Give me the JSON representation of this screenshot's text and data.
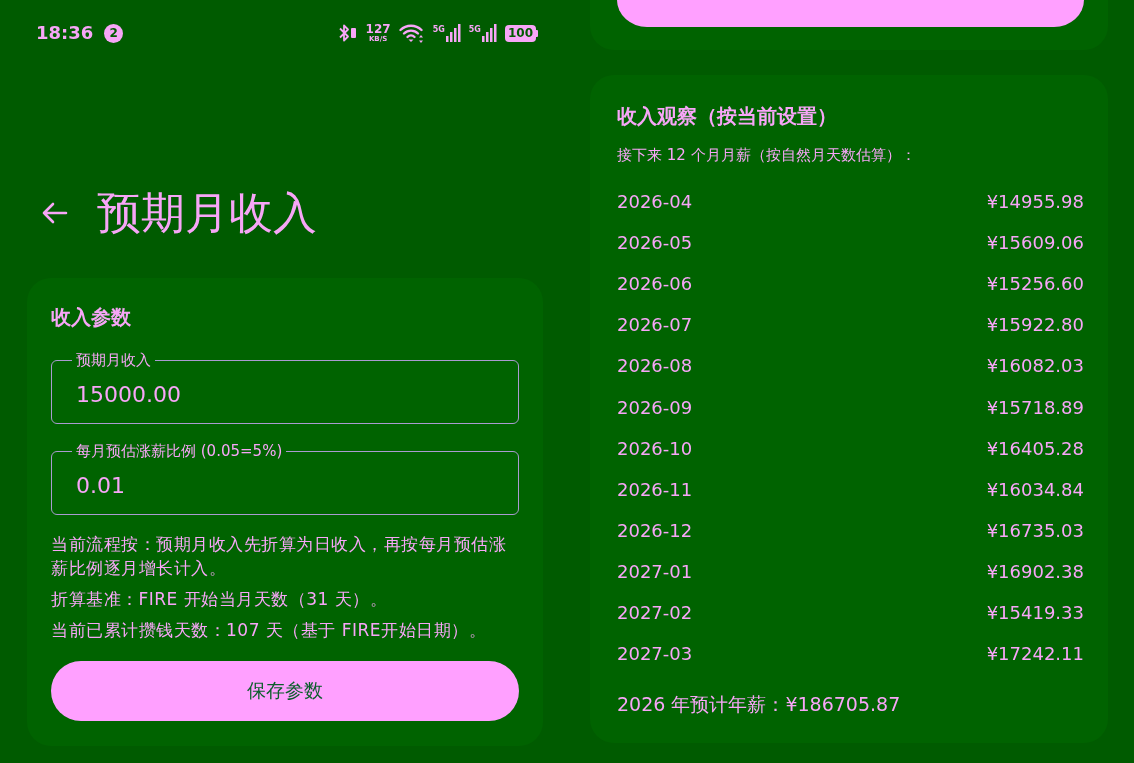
{
  "status_bar": {
    "time": "18:36",
    "notification_count": "2",
    "net_speed": "127",
    "net_speed_unit": "KB/S",
    "signals": [
      {
        "label": "5G"
      },
      {
        "label": "5G"
      }
    ],
    "battery": "100"
  },
  "header": {
    "title": "预期月收入"
  },
  "income_card": {
    "title": "收入参数",
    "fields": [
      {
        "label": "预期月收入",
        "value": "15000.00"
      },
      {
        "label": "每月预估涨薪比例 (0.05=5%)",
        "value": "0.01"
      }
    ],
    "notes": [
      "当前流程按：预期月收入先折算为日收入，再按每月预估涨薪比例逐月增长计入。",
      "折算基准：FIRE 开始当月天数（31 天）。",
      "当前已累计攒钱天数：107 天（基于 FIRE开始日期）。"
    ],
    "button": "保存参数"
  },
  "observation_card": {
    "title": "收入观察（按当前设置）",
    "subtitle": "接下来 12 个月月薪（按自然月天数估算）：",
    "rows": [
      {
        "month": "2026-04",
        "amount": "¥14955.98"
      },
      {
        "month": "2026-05",
        "amount": "¥15609.06"
      },
      {
        "month": "2026-06",
        "amount": "¥15256.60"
      },
      {
        "month": "2026-07",
        "amount": "¥15922.80"
      },
      {
        "month": "2026-08",
        "amount": "¥16082.03"
      },
      {
        "month": "2026-09",
        "amount": "¥15718.89"
      },
      {
        "month": "2026-10",
        "amount": "¥16405.28"
      },
      {
        "month": "2026-11",
        "amount": "¥16034.84"
      },
      {
        "month": "2026-12",
        "amount": "¥16735.03"
      },
      {
        "month": "2027-01",
        "amount": "¥16902.38"
      },
      {
        "month": "2027-02",
        "amount": "¥15419.33"
      },
      {
        "month": "2027-03",
        "amount": "¥17242.11"
      }
    ],
    "annual_total": "2026 年预计年薪：¥186705.87"
  }
}
